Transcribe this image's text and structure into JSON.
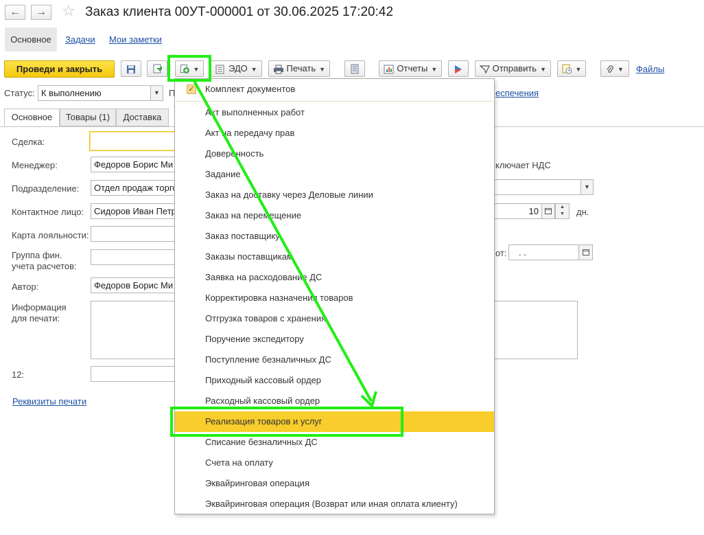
{
  "window": {
    "title": "Заказ клиента 00УТ-000001 от 30.06.2025 17:20:42",
    "back_icon": "←",
    "forward_icon": "→",
    "favorite_icon": "☆"
  },
  "form_tabs": {
    "main": "Основное",
    "tasks": "Задачи",
    "notes": "Мои заметки"
  },
  "toolbar": {
    "post_close": "Проведи и закрыть",
    "edo": "ЭДО",
    "print": "Печать",
    "reports": "Отчеты",
    "send": "Отправить",
    "files": "Файлы"
  },
  "status": {
    "label": "Статус:",
    "value": "К выполнению",
    "truncated_label": "П",
    "provision_link": "еспечения"
  },
  "inner_tabs": {
    "main": "Основное",
    "goods": "Товары (1)",
    "delivery": "Доставка"
  },
  "fields": {
    "deal": {
      "label": "Сделка:",
      "value": ""
    },
    "manager": {
      "label": "Менеджер:",
      "value": "Федоров Борис Ми"
    },
    "division": {
      "label": "Подразделение:",
      "value": "Отдел продаж торго"
    },
    "contact": {
      "label": "Контактное лицо:",
      "value": "Сидоров Иван Петр"
    },
    "loyalty": {
      "label": "Карта лояльности:",
      "value": ""
    },
    "fin_group": {
      "label_1": "Группа фин.",
      "label_2": "учета расчетов:",
      "value": ""
    },
    "author": {
      "label": "Автор:",
      "value": "Федоров Борис Ми"
    },
    "print_info": {
      "label_1": "Информация",
      "label_2": "для печати:",
      "value": ""
    },
    "f12": {
      "label": "12:",
      "value": ""
    },
    "print_details_link": "Реквизиты печати"
  },
  "right_panel": {
    "vat_text": "ключает НДС",
    "days_value": "10",
    "days_unit": "дн.",
    "from_label": "от:",
    "date_value": ".   ."
  },
  "menu": {
    "items": [
      "Комплект документов",
      "Акт выполненных работ",
      "Акт на передачу прав",
      "Доверенность",
      "Задание",
      "Заказ на доставку через Деловые линии",
      "Заказ на перемещение",
      "Заказ поставщику",
      "Заказы поставщикам",
      "Заявка на расходование ДС",
      "Корректировка назначения товаров",
      "Отгрузка товаров с хранения",
      "Поручение экспедитору",
      "Поступление безналичных ДС",
      "Приходный кассовый ордер",
      "Расходный кассовый ордер",
      "Реализация товаров и услуг",
      "Списание безналичных ДС",
      "Счета на оплату",
      "Эквайринговая операция",
      "Эквайринговая операция (Возврат или иная оплата клиенту)"
    ],
    "highlighted": "Реализация товаров и услуг"
  },
  "colors": {
    "primary_button": "#f5c80c",
    "highlight": "#f8cd2c",
    "annotation": "#22ee14",
    "link": "#1d4fa5"
  }
}
